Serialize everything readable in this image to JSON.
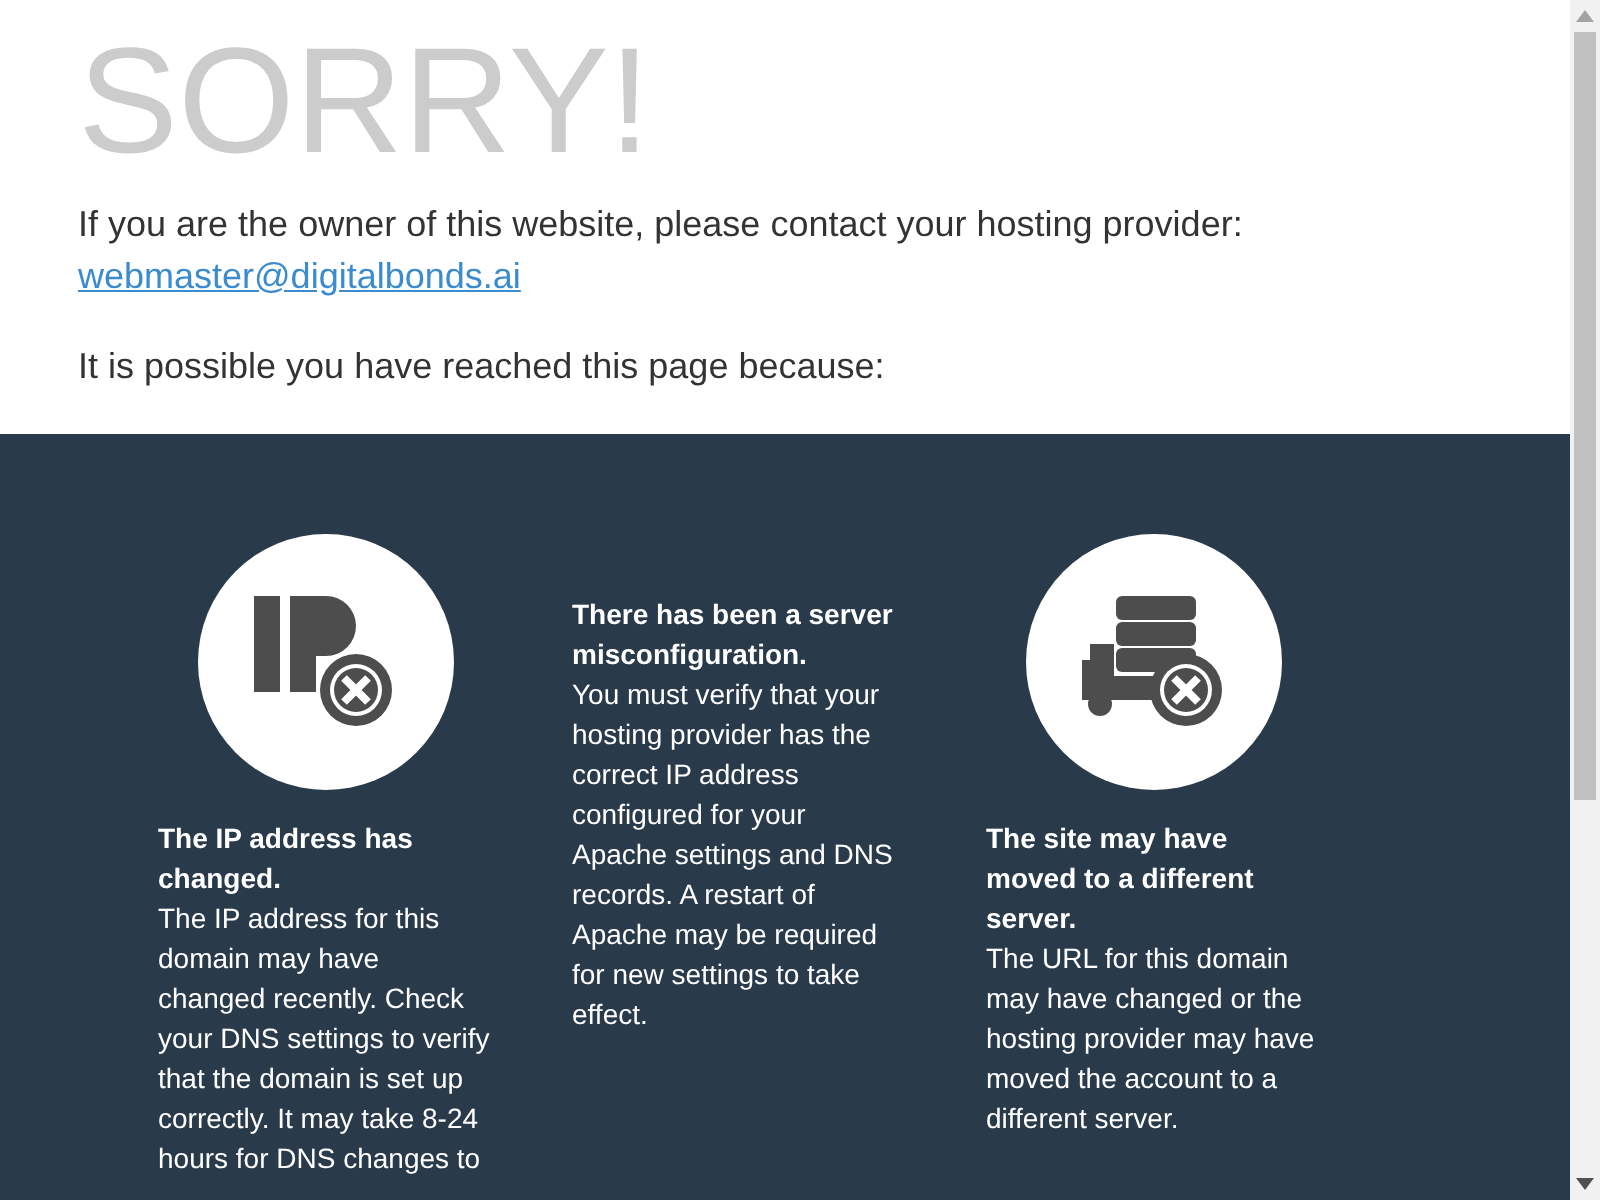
{
  "heading": "SORRY!",
  "owner_text": "If you are the owner of this website, please contact your hosting provider:",
  "email_link": "webmaster@digitalbonds.ai",
  "reasons_intro": "It is possible you have reached this page because:",
  "reasons": [
    {
      "kind": "ip",
      "title": "The IP address has changed.",
      "body": "The IP address for this domain may have changed recently. Check your DNS settings to verify that the domain is set up correctly. It may take 8-24 hours for DNS changes to"
    },
    {
      "kind": "none",
      "title": "There has been a server misconfiguration.",
      "body": "You must verify that your hosting provider has the correct IP address configured for your Apache settings and DNS records. A restart of Apache may be required for new settings to take effect."
    },
    {
      "kind": "server",
      "title": "The site may have moved to a different server.",
      "body": "The URL for this domain may have changed or the hosting provider may have moved the account to a different server."
    }
  ]
}
